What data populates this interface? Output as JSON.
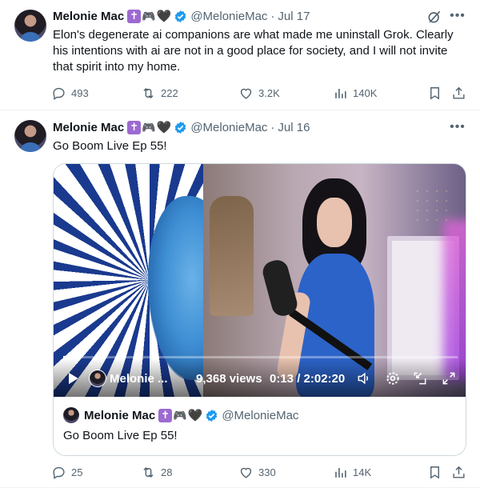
{
  "tweets": [
    {
      "author_name": "Melonie Mac",
      "emoji_cross": "✝",
      "emoji_pad": "🎮",
      "emoji_heart": "🖤",
      "handle": "@MelonieMac",
      "separator": "·",
      "date": "Jul 17",
      "text": "Elon's degenerate ai companions are what made me uninstall Grok. Clearly his intentions with ai are not in a good place for society, and I will not invite that spirit into my home.",
      "replies": "493",
      "reposts": "222",
      "likes": "3.2K",
      "views": "140K"
    },
    {
      "author_name": "Melonie Mac",
      "emoji_cross": "✝",
      "emoji_pad": "🎮",
      "emoji_heart": "🖤",
      "handle": "@MelonieMac",
      "separator": "·",
      "date": "Jul 16",
      "text": "Go Boom Live Ep 55!",
      "video": {
        "channel_name": "Melonie ...",
        "views": "9,368 views",
        "time": "0:13 / 2:02:20",
        "progress_fraction": 0.002
      },
      "quote": {
        "author_name": "Melonie Mac",
        "emoji_cross": "✝",
        "emoji_pad": "🎮",
        "emoji_heart": "🖤",
        "handle": "@MelonieMac",
        "text": "Go Boom Live Ep 55!"
      },
      "replies": "25",
      "reposts": "28",
      "likes": "330",
      "views": "14K"
    }
  ],
  "colors": {
    "text": "#0f1419",
    "secondary": "#536471",
    "verified": "#1d9bf0",
    "border": "#cfd9de",
    "divider": "#eff3f4"
  },
  "icons": [
    "verified-badge-icon",
    "grok-icon",
    "more-icon",
    "reply-icon",
    "repost-icon",
    "like-icon",
    "views-icon",
    "bookmark-icon",
    "share-icon",
    "play-icon",
    "volume-icon",
    "settings-gear-icon",
    "picture-in-picture-icon",
    "fullscreen-icon"
  ]
}
